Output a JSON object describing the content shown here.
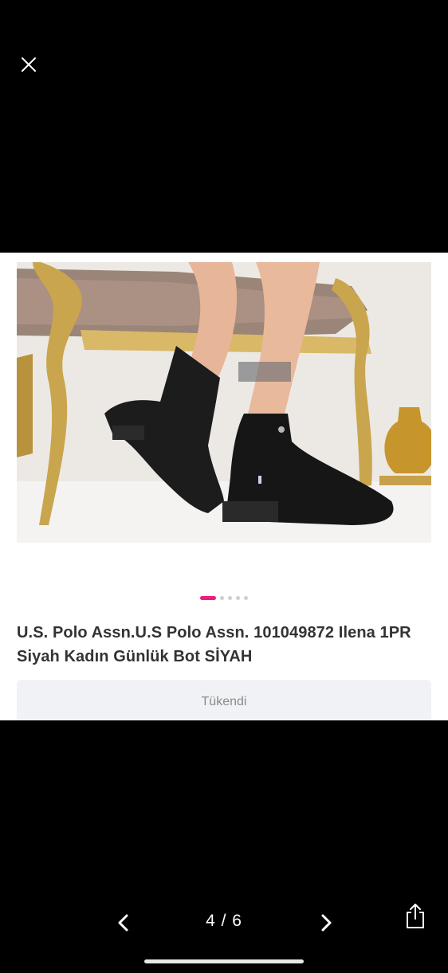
{
  "viewer": {
    "close_icon": "close-icon",
    "counter": "4 / 6",
    "prev_icon": "chevron-left-icon",
    "next_icon": "chevron-right-icon",
    "share_icon": "share-icon"
  },
  "product": {
    "title": "U.S. Polo Assn.U.S Polo Assn. 101049872 Ilena 1PR Siyah Kadın Günlük Bot SİYAH",
    "stock_status": "Tükendi",
    "image_carousel": {
      "total_dots": 5,
      "active_index": 0,
      "active_color": "#ee1d7d",
      "inactive_color": "#cfcfcf"
    }
  }
}
